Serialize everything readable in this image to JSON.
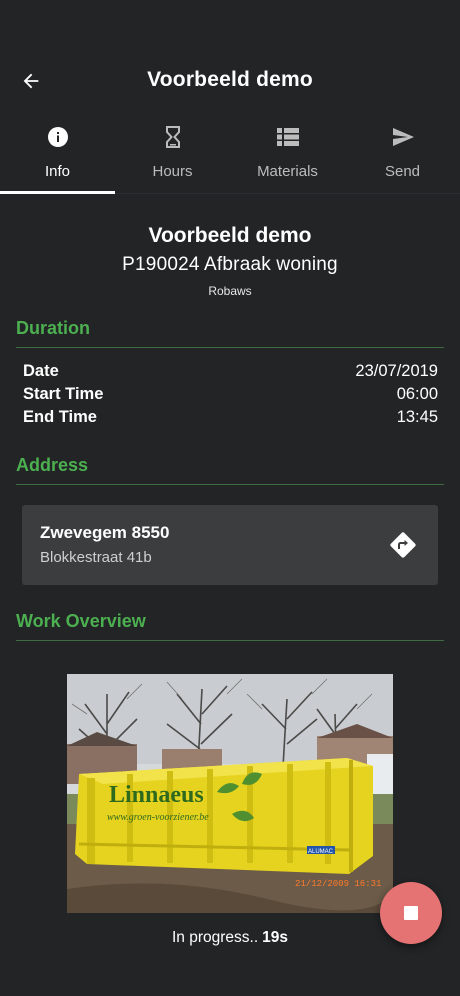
{
  "app_bar": {
    "title": "Voorbeeld demo",
    "back_icon": "arrow-left-icon"
  },
  "tabs": [
    {
      "label": "Info",
      "icon": "info-icon",
      "active": true
    },
    {
      "label": "Hours",
      "icon": "hourglass-icon",
      "active": false
    },
    {
      "label": "Materials",
      "icon": "list-icon",
      "active": false
    },
    {
      "label": "Send",
      "icon": "send-icon",
      "active": false
    }
  ],
  "job": {
    "title": "Voorbeeld demo",
    "subtitle": "P190024 Afbraak woning",
    "company": "Robaws"
  },
  "duration": {
    "header": "Duration",
    "rows": [
      {
        "label": "Date",
        "value": "23/07/2019"
      },
      {
        "label": "Start Time",
        "value": "06:00"
      },
      {
        "label": "End Time",
        "value": "13:45"
      }
    ]
  },
  "address": {
    "header": "Address",
    "city": "Zwevegem 8550",
    "street": "Blokkestraat 41b",
    "nav_icon": "directions-icon"
  },
  "work_overview": {
    "header": "Work Overview",
    "photo": {
      "container_text": "Linnaeus",
      "container_url_text": "www.groen-voorziener.be",
      "timestamp_text": "21/12/2009 16:31",
      "brand_text": "ALUMAC"
    }
  },
  "status": {
    "text": "In progress..",
    "time": "19s"
  },
  "fab": {
    "icon": "stop-icon"
  },
  "colors": {
    "background": "#222426",
    "accent": "#4caf50",
    "card": "#3b3d3f",
    "fab": "#e57373"
  }
}
